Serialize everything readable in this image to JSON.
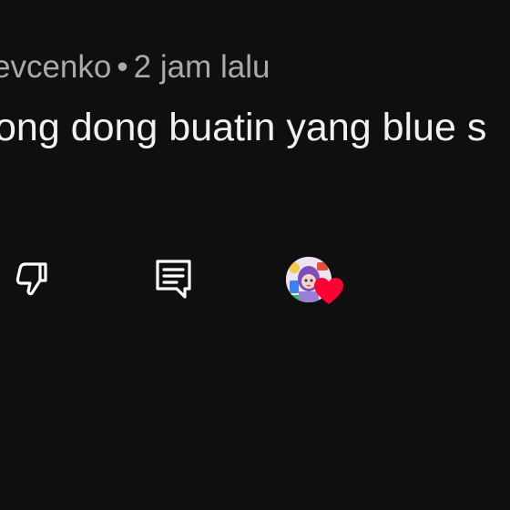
{
  "comment": {
    "author_fragment": "evcenko",
    "separator": "•",
    "timestamp": "2 jam lalu",
    "text": "ong dong buatin yang blue s"
  },
  "actions": {
    "dislike_icon": "thumbs-down-icon",
    "reply_icon": "reply-icon",
    "creator_heart_icon": "creator-heart-icon"
  },
  "colors": {
    "background": "#0f0f0f",
    "meta_text": "#aaaaaa",
    "comment_text": "#f1f1f1",
    "icon_stroke": "#ffffff",
    "heart": "#ff0033"
  }
}
